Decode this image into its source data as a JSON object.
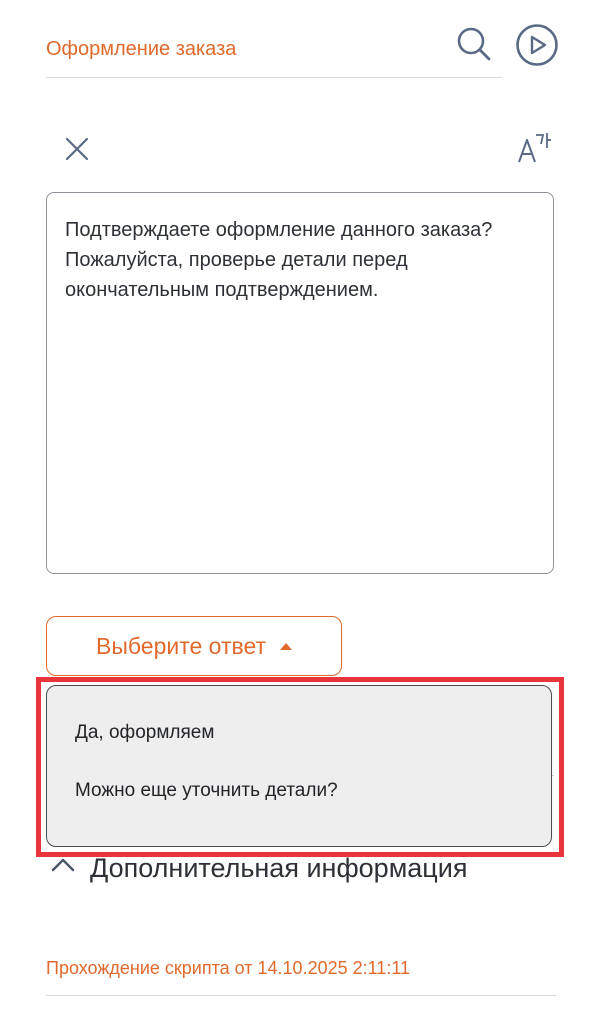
{
  "header": {
    "title": "Оформление заказа",
    "search_icon": "search-icon",
    "play_icon": "play-circle-icon"
  },
  "toolbar": {
    "close_icon": "close-icon",
    "translate_icon": "translate-icon"
  },
  "message": {
    "text": "Подтверждаете оформление данного заказа? Пожалуйста, проверье детали перед окончательным подтверждением."
  },
  "answer_select": {
    "label": "Выберите ответ",
    "state_icon": "caret-up-icon",
    "options": [
      "Да, оформляем",
      "Можно еще уточнить детали?"
    ]
  },
  "additional_info": {
    "label": "Дополнительная информация",
    "icon": "chevron-up-icon"
  },
  "footer": {
    "text": "Прохождение скрипта от 14.10.2025 2:11:11"
  },
  "colors": {
    "accent": "#e06a2c",
    "highlight": "#e8353b",
    "text": "#2d3136",
    "icon": "#5a6a85"
  }
}
